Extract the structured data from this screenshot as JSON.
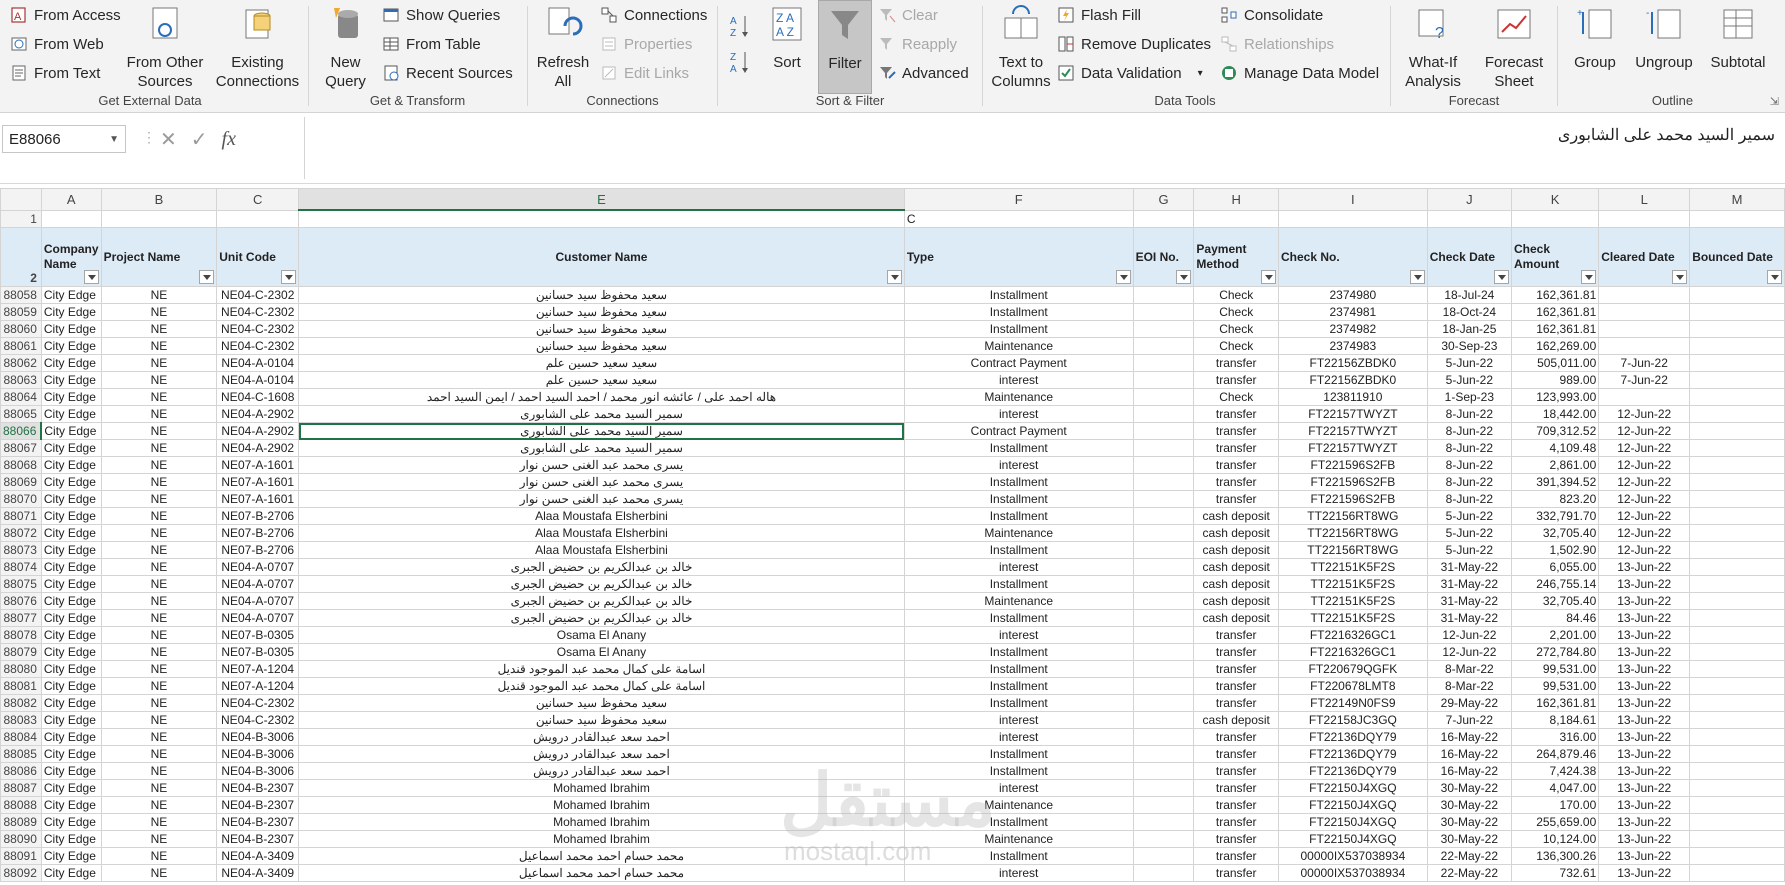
{
  "ribbon": {
    "get_external_data": {
      "label": "Get External Data",
      "from_access": "From Access",
      "from_web": "From Web",
      "from_text": "From Text",
      "from_other_sources": "From Other Sources",
      "existing_connections": "Existing Connections"
    },
    "get_transform": {
      "label": "Get & Transform",
      "new_query": "New Query",
      "show_queries": "Show Queries",
      "from_table": "From Table",
      "recent_sources": "Recent Sources"
    },
    "connections": {
      "label": "Connections",
      "refresh_all": "Refresh All",
      "connections": "Connections",
      "properties": "Properties",
      "edit_links": "Edit Links"
    },
    "sort_filter": {
      "label": "Sort & Filter",
      "sort": "Sort",
      "filter": "Filter",
      "clear": "Clear",
      "reapply": "Reapply",
      "advanced": "Advanced"
    },
    "data_tools": {
      "label": "Data Tools",
      "text_to_columns": "Text to Columns",
      "flash_fill": "Flash Fill",
      "remove_duplicates": "Remove Duplicates",
      "data_validation": "Data Validation",
      "consolidate": "Consolidate",
      "relationships": "Relationships",
      "manage_data_model": "Manage Data Model"
    },
    "forecast": {
      "label": "Forecast",
      "what_if": "What-If Analysis",
      "forecast_sheet": "Forecast Sheet"
    },
    "outline": {
      "label": "Outline",
      "group": "Group",
      "ungroup": "Ungroup",
      "subtotal": "Subtotal"
    }
  },
  "formula_bar": {
    "name_box": "E88066",
    "cancel": "✕",
    "enter": "✓",
    "fx": "fx",
    "content": "سمير السيد محمد على الشابورى"
  },
  "columns": [
    "A",
    "B",
    "C",
    "E",
    "F",
    "G",
    "H",
    "I",
    "J",
    "K",
    "L",
    "M"
  ],
  "row1": {
    "num": "1",
    "f_value": "C"
  },
  "header_row": {
    "num": "2",
    "cells": [
      "Company Name",
      "Project Name",
      "Unit Code",
      "Customer Name",
      "Type",
      "EOI No.",
      "Payment Method",
      "Check No.",
      "Check Date",
      "Check Amount",
      "Cleared Date",
      "Bounced Date"
    ]
  },
  "active_row": "88066",
  "rows": [
    [
      "88058",
      "City Edge",
      "NE",
      "NE04-C-2302",
      "سعيد محفوظ سيد حسانين",
      "Installment",
      "",
      "Check",
      "2374980",
      "18-Jul-24",
      "162,361.81",
      ""
    ],
    [
      "88059",
      "City Edge",
      "NE",
      "NE04-C-2302",
      "سعيد محفوظ سيد حسانين",
      "Installment",
      "",
      "Check",
      "2374981",
      "18-Oct-24",
      "162,361.81",
      ""
    ],
    [
      "88060",
      "City Edge",
      "NE",
      "NE04-C-2302",
      "سعيد محفوظ سيد حسانين",
      "Installment",
      "",
      "Check",
      "2374982",
      "18-Jan-25",
      "162,361.81",
      ""
    ],
    [
      "88061",
      "City Edge",
      "NE",
      "NE04-C-2302",
      "سعيد محفوظ سيد حسانين",
      "Maintenance",
      "",
      "Check",
      "2374983",
      "30-Sep-23",
      "162,269.00",
      ""
    ],
    [
      "88062",
      "City Edge",
      "NE",
      "NE04-A-0104",
      "سعيد سعيد حسين علم",
      "Contract Payment",
      "",
      "transfer",
      "FT22156ZBDK0",
      "5-Jun-22",
      "505,011.00",
      "7-Jun-22"
    ],
    [
      "88063",
      "City Edge",
      "NE",
      "NE04-A-0104",
      "سعيد سعيد حسين علم",
      "interest",
      "",
      "transfer",
      "FT22156ZBDK0",
      "5-Jun-22",
      "989.00",
      "7-Jun-22"
    ],
    [
      "88064",
      "City Edge",
      "NE",
      "NE04-C-1608",
      "هاله احمد على / عائشه انور محمد / احمد السيد احمد / ايمن السيد احمد",
      "Maintenance",
      "",
      "Check",
      "123811910",
      "1-Sep-23",
      "123,993.00",
      ""
    ],
    [
      "88065",
      "City Edge",
      "NE",
      "NE04-A-2902",
      "سمير السيد محمد على الشابورى",
      "interest",
      "",
      "transfer",
      "FT22157TWYZT",
      "8-Jun-22",
      "18,442.00",
      "12-Jun-22"
    ],
    [
      "88066",
      "City Edge",
      "NE",
      "NE04-A-2902",
      "سمير السيد محمد على الشابورى",
      "Contract Payment",
      "",
      "transfer",
      "FT22157TWYZT",
      "8-Jun-22",
      "709,312.52",
      "12-Jun-22"
    ],
    [
      "88067",
      "City Edge",
      "NE",
      "NE04-A-2902",
      "سمير السيد محمد على الشابورى",
      "Installment",
      "",
      "transfer",
      "FT22157TWYZT",
      "8-Jun-22",
      "4,109.48",
      "12-Jun-22"
    ],
    [
      "88068",
      "City Edge",
      "NE",
      "NE07-A-1601",
      "يسرى محمد عبد الغنى حسن نوار",
      "interest",
      "",
      "transfer",
      "FT221596S2FB",
      "8-Jun-22",
      "2,861.00",
      "12-Jun-22"
    ],
    [
      "88069",
      "City Edge",
      "NE",
      "NE07-A-1601",
      "يسرى محمد عبد الغنى حسن نوار",
      "Installment",
      "",
      "transfer",
      "FT221596S2FB",
      "8-Jun-22",
      "391,394.52",
      "12-Jun-22"
    ],
    [
      "88070",
      "City Edge",
      "NE",
      "NE07-A-1601",
      "يسرى محمد عبد الغنى حسن نوار",
      "Installment",
      "",
      "transfer",
      "FT221596S2FB",
      "8-Jun-22",
      "823.20",
      "12-Jun-22"
    ],
    [
      "88071",
      "City Edge",
      "NE",
      "NE07-B-2706",
      "Alaa Moustafa Elsherbini",
      "Installment",
      "",
      "cash deposit",
      "TT22156RT8WG",
      "5-Jun-22",
      "332,791.70",
      "12-Jun-22"
    ],
    [
      "88072",
      "City Edge",
      "NE",
      "NE07-B-2706",
      "Alaa Moustafa Elsherbini",
      "Maintenance",
      "",
      "cash deposit",
      "TT22156RT8WG",
      "5-Jun-22",
      "32,705.40",
      "12-Jun-22"
    ],
    [
      "88073",
      "City Edge",
      "NE",
      "NE07-B-2706",
      "Alaa Moustafa Elsherbini",
      "Installment",
      "",
      "cash deposit",
      "TT22156RT8WG",
      "5-Jun-22",
      "1,502.90",
      "12-Jun-22"
    ],
    [
      "88074",
      "City Edge",
      "NE",
      "NE04-A-0707",
      "خالد بن عبدالكريم بن حضيض الجبرى",
      "interest",
      "",
      "cash deposit",
      "TT22151K5F2S",
      "31-May-22",
      "6,055.00",
      "13-Jun-22"
    ],
    [
      "88075",
      "City Edge",
      "NE",
      "NE04-A-0707",
      "خالد بن عبدالكريم بن حضيض الجبرى",
      "Installment",
      "",
      "cash deposit",
      "TT22151K5F2S",
      "31-May-22",
      "246,755.14",
      "13-Jun-22"
    ],
    [
      "88076",
      "City Edge",
      "NE",
      "NE04-A-0707",
      "خالد بن عبدالكريم بن حضيض الجبرى",
      "Maintenance",
      "",
      "cash deposit",
      "TT22151K5F2S",
      "31-May-22",
      "32,705.40",
      "13-Jun-22"
    ],
    [
      "88077",
      "City Edge",
      "NE",
      "NE04-A-0707",
      "خالد بن عبدالكريم بن حضيض الجبرى",
      "Installment",
      "",
      "cash deposit",
      "TT22151K5F2S",
      "31-May-22",
      "84.46",
      "13-Jun-22"
    ],
    [
      "88078",
      "City Edge",
      "NE",
      "NE07-B-0305",
      "Osama El Anany",
      "interest",
      "",
      "transfer",
      "FT2216326GC1",
      "12-Jun-22",
      "2,201.00",
      "13-Jun-22"
    ],
    [
      "88079",
      "City Edge",
      "NE",
      "NE07-B-0305",
      "Osama El Anany",
      "Installment",
      "",
      "transfer",
      "FT2216326GC1",
      "12-Jun-22",
      "272,784.80",
      "13-Jun-22"
    ],
    [
      "88080",
      "City Edge",
      "NE",
      "NE07-A-1204",
      "اسامة على كمال محمد عبد الموجود قنديل",
      "Installment",
      "",
      "transfer",
      "FT220679QGFK",
      "8-Mar-22",
      "99,531.00",
      "13-Jun-22"
    ],
    [
      "88081",
      "City Edge",
      "NE",
      "NE07-A-1204",
      "اسامة على كمال محمد عبد الموجود قنديل",
      "Installment",
      "",
      "transfer",
      "FT220678LMT8",
      "8-Mar-22",
      "99,531.00",
      "13-Jun-22"
    ],
    [
      "88082",
      "City Edge",
      "NE",
      "NE04-C-2302",
      "سعيد محفوظ سيد حسانين",
      "Installment",
      "",
      "transfer",
      "FT22149N0FS9",
      "29-May-22",
      "162,361.81",
      "13-Jun-22"
    ],
    [
      "88083",
      "City Edge",
      "NE",
      "NE04-C-2302",
      "سعيد محفوظ سيد حسانين",
      "interest",
      "",
      "cash deposit",
      "FT22158JC3GQ",
      "7-Jun-22",
      "8,184.61",
      "13-Jun-22"
    ],
    [
      "88084",
      "City Edge",
      "NE",
      "NE04-B-3006",
      "احمد سعد عبدالقادر درويش",
      "interest",
      "",
      "transfer",
      "FT22136DQY79",
      "16-May-22",
      "316.00",
      "13-Jun-22"
    ],
    [
      "88085",
      "City Edge",
      "NE",
      "NE04-B-3006",
      "احمد سعد عبدالقادر درويش",
      "Installment",
      "",
      "transfer",
      "FT22136DQY79",
      "16-May-22",
      "264,879.46",
      "13-Jun-22"
    ],
    [
      "88086",
      "City Edge",
      "NE",
      "NE04-B-3006",
      "احمد سعد عبدالقادر درويش",
      "Installment",
      "",
      "transfer",
      "FT22136DQY79",
      "16-May-22",
      "7,424.38",
      "13-Jun-22"
    ],
    [
      "88087",
      "City Edge",
      "NE",
      "NE04-B-2307",
      "Mohamed Ibrahim",
      "interest",
      "",
      "transfer",
      "FT22150J4XGQ",
      "30-May-22",
      "4,047.00",
      "13-Jun-22"
    ],
    [
      "88088",
      "City Edge",
      "NE",
      "NE04-B-2307",
      "Mohamed Ibrahim",
      "Maintenance",
      "",
      "transfer",
      "FT22150J4XGQ",
      "30-May-22",
      "170.00",
      "13-Jun-22"
    ],
    [
      "88089",
      "City Edge",
      "NE",
      "NE04-B-2307",
      "Mohamed Ibrahim",
      "Installment",
      "",
      "transfer",
      "FT22150J4XGQ",
      "30-May-22",
      "255,659.00",
      "13-Jun-22"
    ],
    [
      "88090",
      "City Edge",
      "NE",
      "NE04-B-2307",
      "Mohamed Ibrahim",
      "Maintenance",
      "",
      "transfer",
      "FT22150J4XGQ",
      "30-May-22",
      "10,124.00",
      "13-Jun-22"
    ],
    [
      "88091",
      "City Edge",
      "NE",
      "NE04-A-3409",
      "محمد حسام احمد محمد اسماعيل",
      "Installment",
      "",
      "transfer",
      "00000IX537038934",
      "22-May-22",
      "136,300.26",
      "13-Jun-22"
    ],
    [
      "88092",
      "City Edge",
      "NE",
      "NE04-A-3409",
      "محمد حسام احمد محمد اسماعيل",
      "interest",
      "",
      "transfer",
      "00000IX537038934",
      "22-May-22",
      "732.61",
      "13-Jun-22"
    ]
  ],
  "watermark": {
    "arabic": "مستقل",
    "latin": "mostaql.com"
  }
}
